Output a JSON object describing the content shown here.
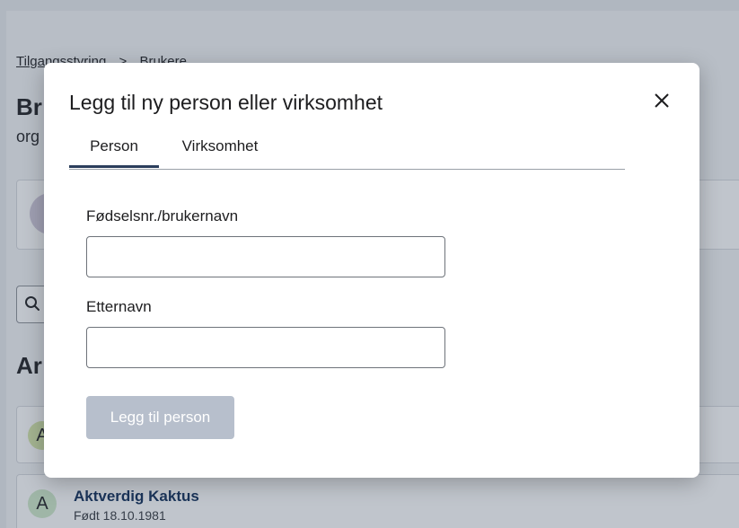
{
  "background_page": {
    "breadcrumb": [
      "Tilgangsstyring",
      "Brukere"
    ],
    "breadcrumb_sep": ">",
    "title": "Br",
    "subtitle": "org",
    "section_heading": "Ar",
    "users": [
      {
        "initial": "A",
        "name": "",
        "born": ""
      },
      {
        "initial": "A",
        "name": "Aktverdig Kaktus",
        "born": "Født 18.10.1981"
      }
    ]
  },
  "modal": {
    "title": "Legg til ny person eller virksomhet",
    "tabs": [
      "Person",
      "Virksomhet"
    ],
    "active_tab": "Person",
    "fields": {
      "id_label": "Fødselsnr./brukernavn",
      "id_value": "",
      "lastname_label": "Etternavn",
      "lastname_value": ""
    },
    "submit_label": "Legg til person",
    "close_icon": "close-icon"
  },
  "colors": {
    "accent": "#2b3e5c",
    "button_disabled": "#b7bfcc",
    "user_name": "#0b2a56"
  }
}
